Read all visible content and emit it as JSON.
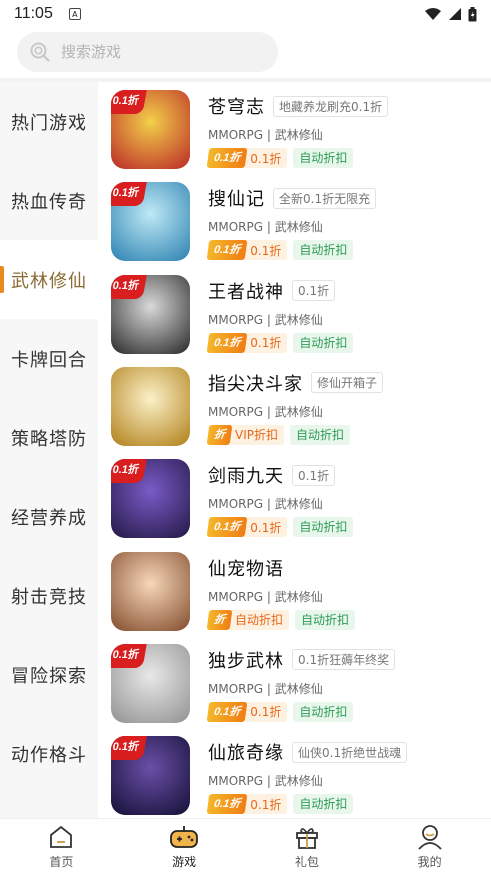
{
  "status": {
    "time": "11:05",
    "notif_glyph": "A"
  },
  "search": {
    "placeholder": "搜索游戏"
  },
  "sidebar": {
    "active_index": 2,
    "items": [
      {
        "label": "热门游戏"
      },
      {
        "label": "热血传奇"
      },
      {
        "label": "武林修仙"
      },
      {
        "label": "卡牌回合"
      },
      {
        "label": "策略塔防"
      },
      {
        "label": "经营养成"
      },
      {
        "label": "射击竞技"
      },
      {
        "label": "冒险探索"
      },
      {
        "label": "动作格斗"
      }
    ]
  },
  "games": [
    {
      "name": "苍穹志",
      "tag": "地藏养龙刷充0.1折",
      "meta": "MMORPG | 武林修仙",
      "badge": "0.1折",
      "chip_label": "0.1折",
      "chip_value": "0.1折",
      "auto": "自动折扣",
      "art_colors": [
        "#f3d04a",
        "#c0392b"
      ]
    },
    {
      "name": "搜仙记",
      "tag": "全新0.1折无限充",
      "meta": "MMORPG | 武林修仙",
      "badge": "0.1折",
      "chip_label": "0.1折",
      "chip_value": "0.1折",
      "auto": "自动折扣",
      "art_colors": [
        "#bfe9f5",
        "#3a8bb8"
      ]
    },
    {
      "name": "王者战神",
      "tag": "0.1折",
      "meta": "MMORPG | 武林修仙",
      "badge": "0.1折",
      "chip_label": "0.1折",
      "chip_value": "0.1折",
      "auto": "自动折扣",
      "art_colors": [
        "#d9d9d9",
        "#3a3a3a"
      ]
    },
    {
      "name": "指尖决斗家",
      "tag": "修仙开箱子",
      "meta": "MMORPG | 武林修仙",
      "badge": "",
      "chip_label": "折",
      "chip_value": "VIP折扣",
      "auto": "自动折扣",
      "art_colors": [
        "#fbf1c8",
        "#b88a2a"
      ]
    },
    {
      "name": "剑雨九天",
      "tag": "0.1折",
      "meta": "MMORPG | 武林修仙",
      "badge": "0.1折",
      "chip_label": "0.1折",
      "chip_value": "0.1折",
      "auto": "自动折扣",
      "art_colors": [
        "#7a5bc8",
        "#2c1f52"
      ]
    },
    {
      "name": "仙宠物语",
      "tag": "",
      "meta": "MMORPG | 武林修仙",
      "badge": "",
      "chip_label": "折",
      "chip_value": "自动折扣",
      "auto": "自动折扣",
      "art_colors": [
        "#f7d7b9",
        "#8d5a3a"
      ]
    },
    {
      "name": "独步武林",
      "tag": "0.1折狂薅年终奖",
      "meta": "MMORPG | 武林修仙",
      "badge": "0.1折",
      "chip_label": "0.1折",
      "chip_value": "0.1折",
      "auto": "自动折扣",
      "art_colors": [
        "#e8e8e8",
        "#9a9a9a"
      ]
    },
    {
      "name": "仙旅奇缘",
      "tag": "仙侠0.1折绝世战魂",
      "meta": "MMORPG | 武林修仙",
      "badge": "0.1折",
      "chip_label": "0.1折",
      "chip_value": "0.1折",
      "auto": "自动折扣",
      "art_colors": [
        "#6b4fa8",
        "#1c1640"
      ]
    }
  ],
  "tabs": [
    {
      "label": "首页",
      "icon": "home-icon"
    },
    {
      "label": "游戏",
      "icon": "gamepad-icon",
      "active": true
    },
    {
      "label": "礼包",
      "icon": "gift-icon"
    },
    {
      "label": "我的",
      "icon": "profile-icon"
    }
  ]
}
